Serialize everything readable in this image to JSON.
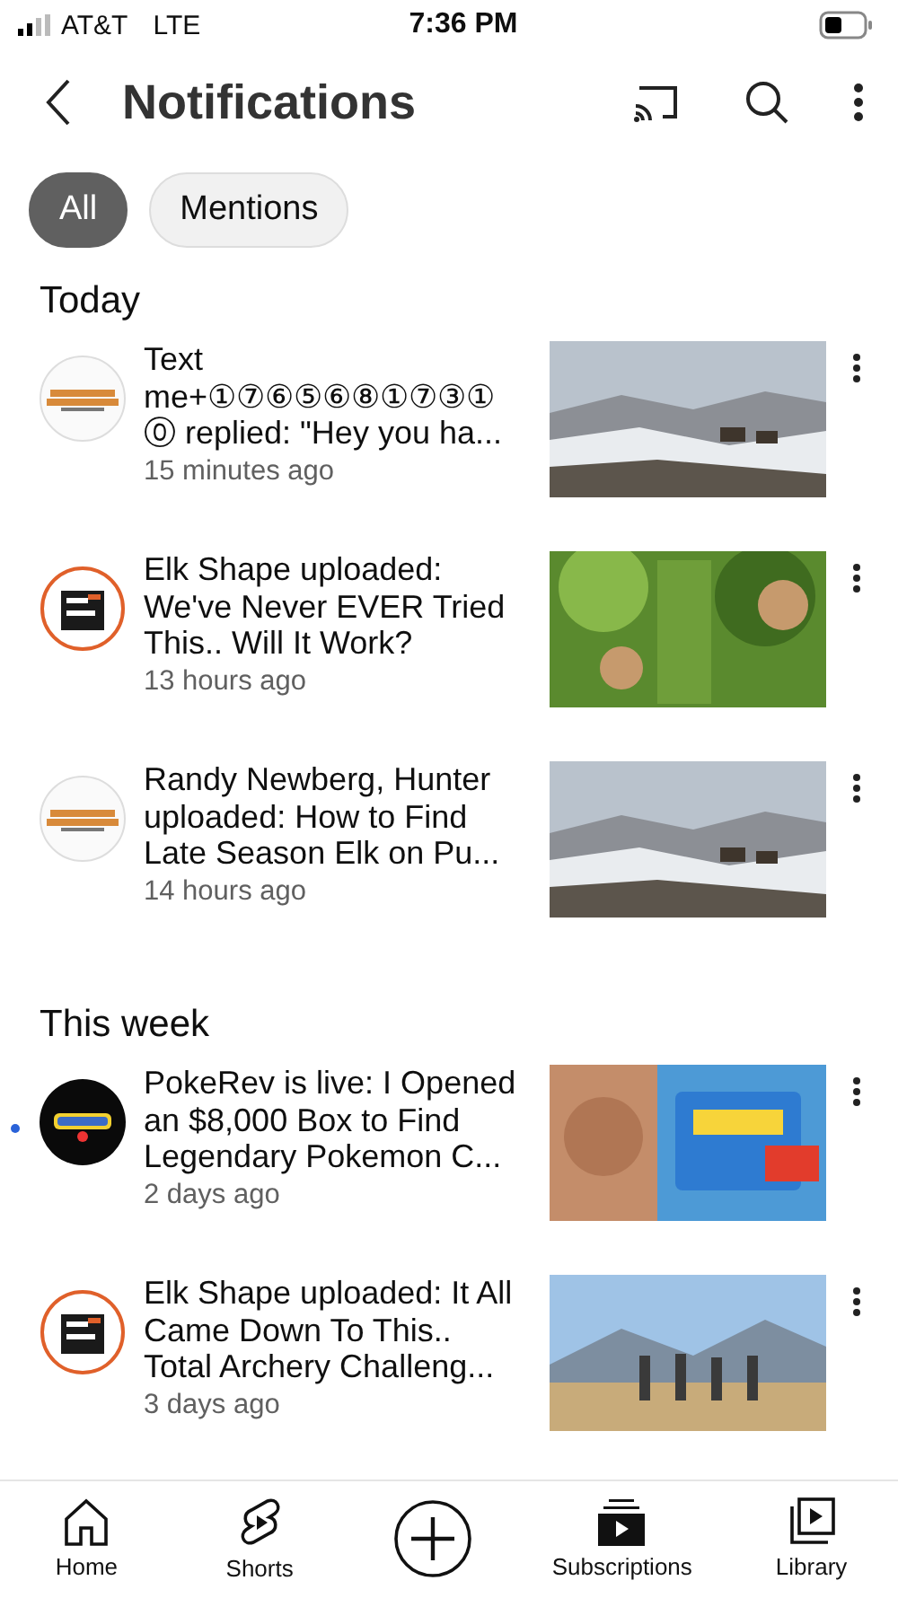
{
  "status_bar": {
    "carrier": "AT&T",
    "network": "LTE",
    "time": "7:36 PM"
  },
  "header": {
    "title": "Notifications"
  },
  "chips": [
    {
      "label": "All",
      "selected": true
    },
    {
      "label": "Mentions",
      "selected": false
    }
  ],
  "sections": [
    {
      "title": "Today",
      "notifications": [
        {
          "text": "Text me+①⑦⑥⑤⑥⑧①⑦③①⓪ replied: \"Hey you ha...",
          "time": "15 minutes ago",
          "unread": false
        },
        {
          "text": "Elk Shape uploaded: We've Never EVER Tried This.. Will It Work?",
          "time": "13 hours ago",
          "unread": false
        },
        {
          "text": "Randy Newberg, Hunter uploaded: How to Find Late Season Elk on Pu...",
          "time": "14 hours ago",
          "unread": false
        }
      ]
    },
    {
      "title": "This week",
      "notifications": [
        {
          "text": "PokeRev is live: I Opened an $8,000 Box to Find Legendary Pokemon C...",
          "time": "2 days ago",
          "unread": true
        },
        {
          "text": "Elk Shape uploaded: It All Came Down To This.. Total Archery Challeng...",
          "time": "3 days ago",
          "unread": false
        }
      ]
    }
  ],
  "bottom_nav": [
    {
      "label": "Home",
      "kind": "home"
    },
    {
      "label": "Shorts",
      "kind": "shorts"
    },
    {
      "kind": "create"
    },
    {
      "label": "Subscriptions",
      "kind": "subscriptions"
    },
    {
      "label": "Library",
      "kind": "library"
    }
  ]
}
